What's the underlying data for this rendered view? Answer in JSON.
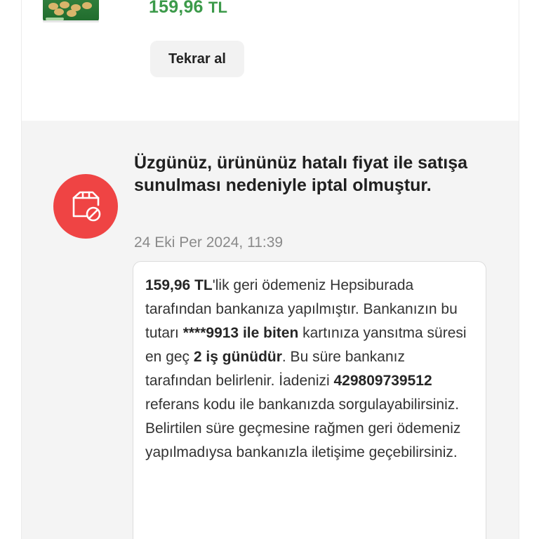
{
  "product": {
    "image_icon": "nut-snack-package-image",
    "price_value": "159,96",
    "price_currency": "TL",
    "price_color": "#3c9a4a"
  },
  "actions": {
    "rebuy_label": "Tekrar al"
  },
  "status": {
    "icon": "package-cancel-icon",
    "icon_color": "#ef4444",
    "headline": "Üzgünüz, ürününüz hatalı fiyat ile satışa sunulması nedeniyle iptal olmuştur.",
    "date": "24 Eki Per 2024, 11:39"
  },
  "refund_message": {
    "amount": "159,96 TL",
    "t1": "'lik geri ödemeniz Hepsiburada tarafından bankanıza yapılmıştır. Bankanızın bu tutarı ",
    "card": "****9913 ile biten",
    "t2": " kartınıza yansıtma süresi en geç ",
    "duration": "2 iş günüdür",
    "t3": ". Bu süre bankanız tarafından belirlenir. İadenizi ",
    "reference": "429809739512",
    "t4": " referans kodu ile bankanızda sorgulayabilirsiniz. Belirtilen süre geçmesine rağmen geri ödemeniz yapılmadıysa bankanızla iletişime geçebilirsiniz."
  }
}
